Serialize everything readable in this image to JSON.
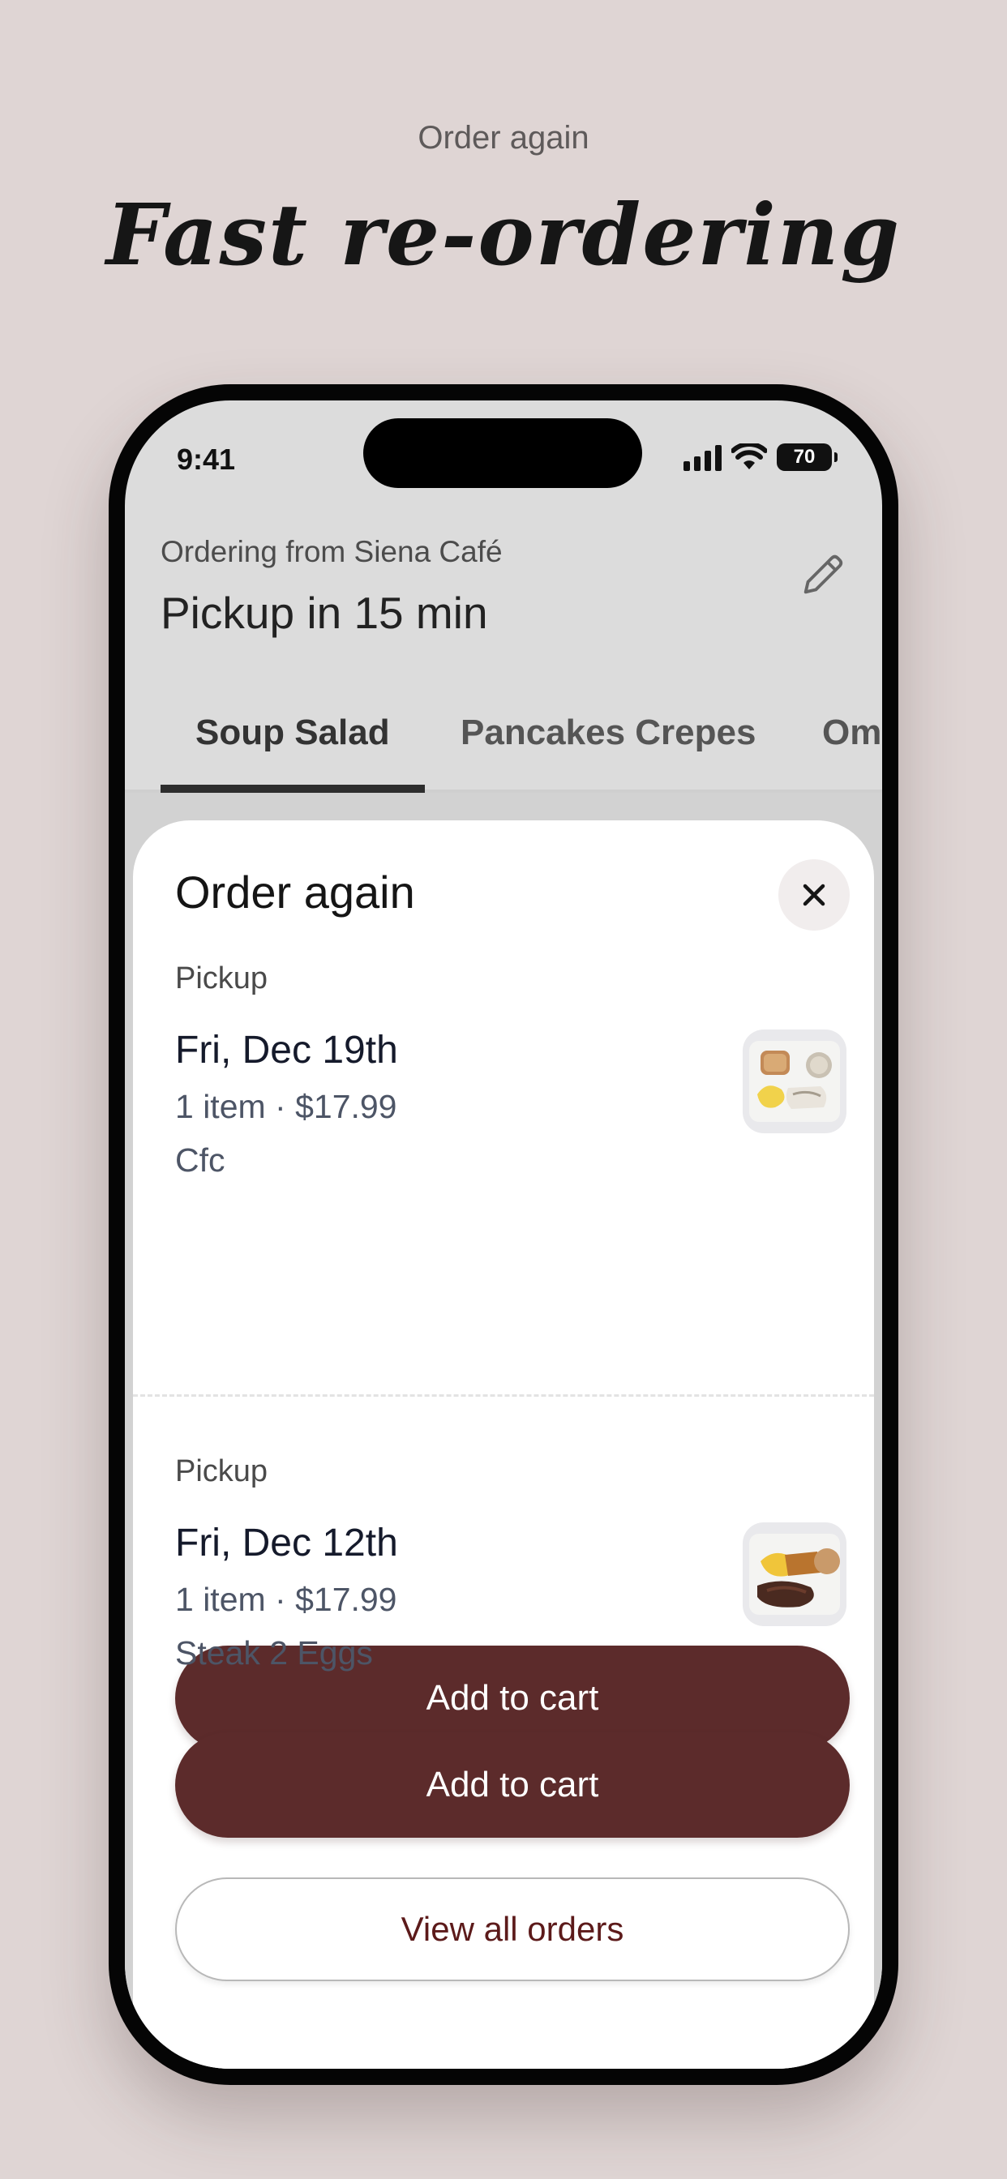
{
  "promo": {
    "subtitle": "Order again",
    "title": "Fast re-ordering"
  },
  "status_bar": {
    "time": "9:41",
    "battery": "70"
  },
  "header": {
    "ordering_from": "Ordering from Siena Café",
    "pickup_time": "Pickup in 15 min"
  },
  "tabs": [
    {
      "label": "Soup Salad",
      "active": true
    },
    {
      "label": "Pancakes Crepes",
      "active": false
    },
    {
      "label": "Ome",
      "active": false
    }
  ],
  "sheet": {
    "title": "Order again",
    "orders": [
      {
        "type": "Pickup",
        "date": "Fri, Dec 19th",
        "summary": "1 item · $17.99",
        "name": "Cfc",
        "button": "Add to cart"
      },
      {
        "type": "Pickup",
        "date": "Fri, Dec 12th",
        "summary": "1 item · $17.99",
        "name": "Steak 2 Eggs",
        "button": "Add to cart"
      }
    ],
    "view_all": "View all orders"
  },
  "colors": {
    "brand": "#5c2b2b",
    "background": "#dfd5d4"
  }
}
